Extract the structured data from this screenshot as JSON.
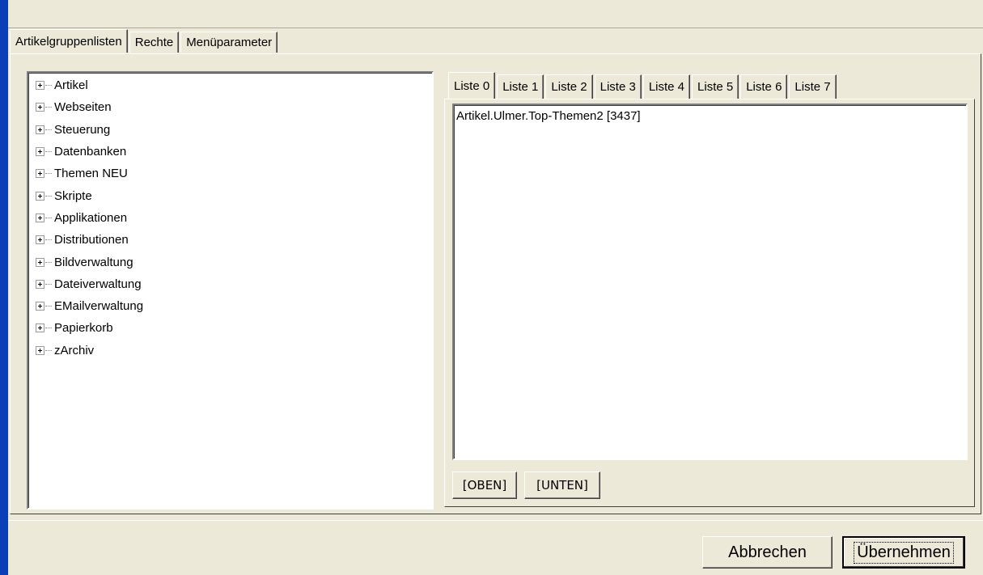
{
  "main_tabs": [
    {
      "label": "Artikelgruppenlisten",
      "active": true
    },
    {
      "label": "Rechte",
      "active": false
    },
    {
      "label": "Menüparameter",
      "active": false
    }
  ],
  "tree": {
    "items": [
      {
        "label": "Artikel"
      },
      {
        "label": "Webseiten"
      },
      {
        "label": "Steuerung"
      },
      {
        "label": "Datenbanken"
      },
      {
        "label": "Themen NEU"
      },
      {
        "label": "Skripte"
      },
      {
        "label": "Applikationen"
      },
      {
        "label": "Distributionen"
      },
      {
        "label": "Bildverwaltung"
      },
      {
        "label": "Dateiverwaltung"
      },
      {
        "label": "EMailverwaltung"
      },
      {
        "label": "Papierkorb"
      },
      {
        "label": "zArchiv"
      }
    ],
    "expand_icon": "plus-box-icon"
  },
  "list_tabs": [
    {
      "label": "Liste 0",
      "active": true
    },
    {
      "label": "Liste 1",
      "active": false
    },
    {
      "label": "Liste 2",
      "active": false
    },
    {
      "label": "Liste 3",
      "active": false
    },
    {
      "label": "Liste 4",
      "active": false
    },
    {
      "label": "Liste 5",
      "active": false
    },
    {
      "label": "Liste 6",
      "active": false
    },
    {
      "label": "Liste 7",
      "active": false
    }
  ],
  "list": {
    "entries": [
      "Artikel.Ulmer.Top-Themen2 [3437]"
    ],
    "up_label": "[OBEN]",
    "down_label": "[UNTEN]"
  },
  "footer": {
    "cancel_label": "Abbrechen",
    "apply_label": "Übernehmen"
  },
  "colors": {
    "window_bg": "#ece9d8",
    "left_accent": "#0a3fb8"
  }
}
